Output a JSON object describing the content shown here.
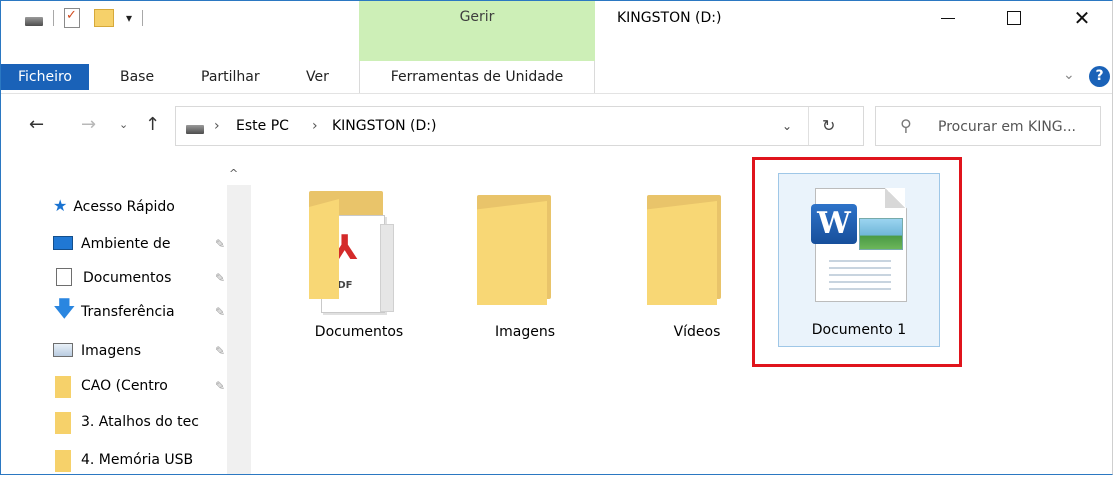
{
  "window": {
    "title": "KINGSTON (D:)",
    "context_tab": "Gerir",
    "controls": {
      "minimize": "minimize-icon",
      "maximize": "maximize-icon",
      "close": "✕"
    }
  },
  "quick_access_toolbar": {
    "dropdown": "▾"
  },
  "ribbon": {
    "tabs": [
      "Ficheiro",
      "Base",
      "Partilhar",
      "Ver",
      "Ferramentas de Unidade"
    ],
    "expand": "⌄",
    "help": "?"
  },
  "navigation": {
    "back": "←",
    "forward": "→",
    "recent": "⌄",
    "up": "↑",
    "breadcrumb": [
      "Este PC",
      "KINGSTON (D:)"
    ],
    "separator": "›",
    "dropdown": "⌄",
    "refresh": "↻"
  },
  "search": {
    "placeholder": "Procurar em KING..."
  },
  "nav_pane": {
    "scroll_up": "^",
    "quick_access": "Acesso Rápido",
    "pin": "📌",
    "items": [
      {
        "label": "Ambiente de",
        "icon": "desktop-icon"
      },
      {
        "label": "Documentos",
        "icon": "documents-icon"
      },
      {
        "label": "Transferência",
        "icon": "download-icon"
      },
      {
        "label": "Imagens",
        "icon": "pictures-icon"
      },
      {
        "label": "CAO (Centro",
        "icon": "folder-icon"
      },
      {
        "label": "3. Atalhos do tec",
        "icon": "folder-icon"
      },
      {
        "label": "4. Memória USB",
        "icon": "folder-icon"
      }
    ]
  },
  "content": {
    "items": [
      {
        "name": "Documentos",
        "type": "folder"
      },
      {
        "name": "Imagens",
        "type": "folder"
      },
      {
        "name": "Vídeos",
        "type": "folder"
      },
      {
        "name": "Documento 1",
        "type": "word-document",
        "selected": true
      }
    ],
    "pdf_label": "PDF",
    "word_letter": "W"
  },
  "colors": {
    "accent": "#1a62b8",
    "context_tab": "#cdefb7",
    "highlight": "#e0141c",
    "folder": "#f8d775"
  }
}
